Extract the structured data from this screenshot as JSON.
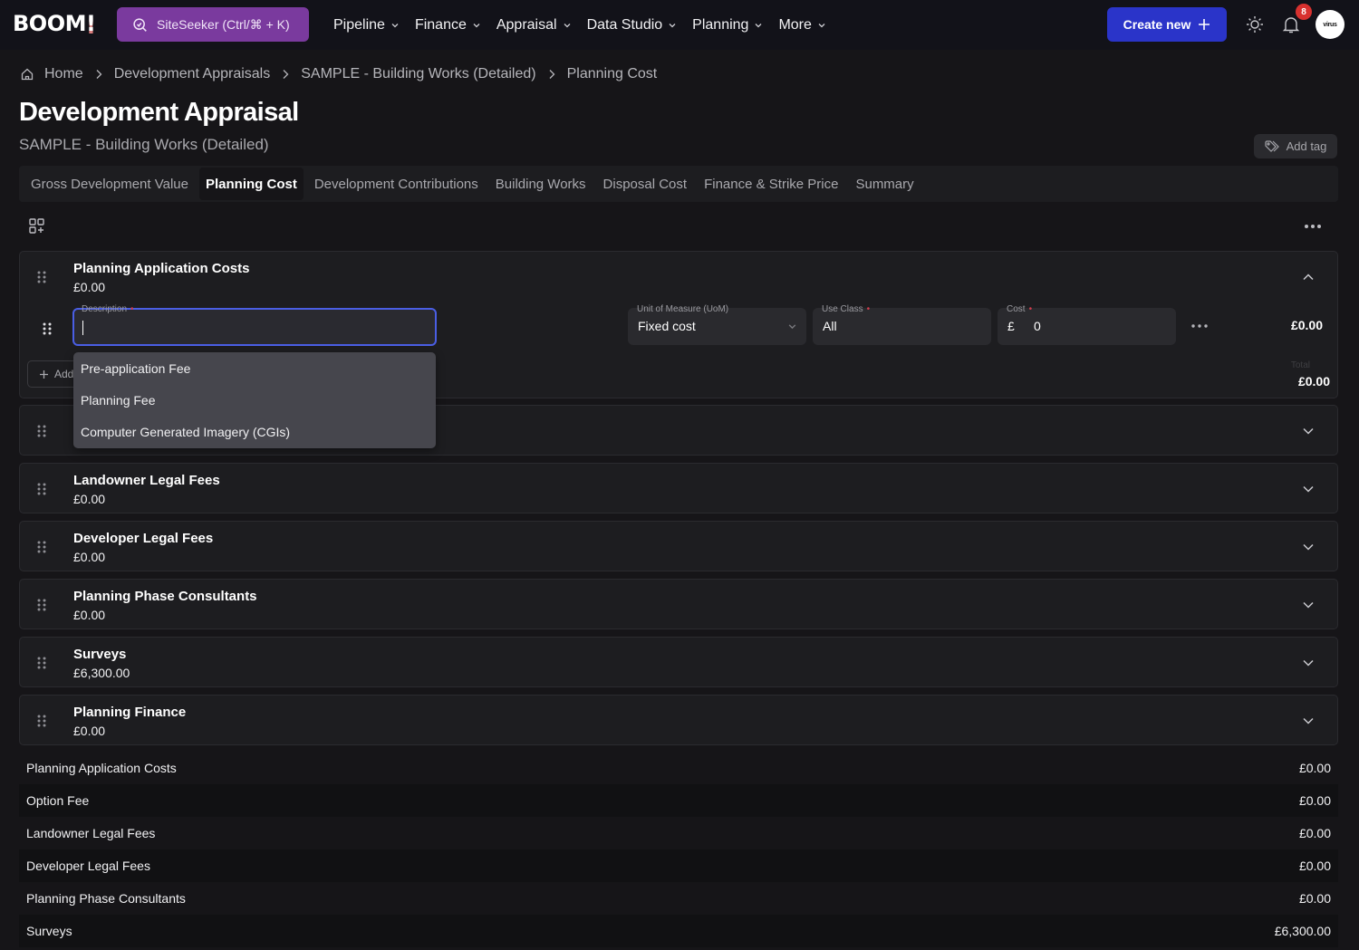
{
  "navbar": {
    "logo": "BOOM",
    "logo_bang": "!",
    "siteseeker_label": "SiteSeeker (Ctrl/⌘ + K)",
    "menu": [
      {
        "label": "Pipeline"
      },
      {
        "label": "Finance"
      },
      {
        "label": "Appraisal"
      },
      {
        "label": "Data Studio"
      },
      {
        "label": "Planning"
      },
      {
        "label": "More"
      }
    ],
    "create_new_label": "Create new",
    "notification_count": "8",
    "avatar_text": "virus"
  },
  "breadcrumb": [
    "Home",
    "Development Appraisals",
    "SAMPLE - Building Works (Detailed)",
    "Planning Cost"
  ],
  "header": {
    "title": "Development Appraisal",
    "subtitle": "SAMPLE - Building Works (Detailed)",
    "add_tag_label": "Add tag"
  },
  "tabs": [
    {
      "label": "Gross Development Value",
      "active": false
    },
    {
      "label": "Planning Cost",
      "active": true
    },
    {
      "label": "Development Contributions",
      "active": false
    },
    {
      "label": "Building Works",
      "active": false
    },
    {
      "label": "Disposal Cost",
      "active": false
    },
    {
      "label": "Finance & Strike Price",
      "active": false
    },
    {
      "label": "Summary",
      "active": false
    }
  ],
  "expanded_section": {
    "title": "Planning Application Costs",
    "amount": "£0.00",
    "row": {
      "description_label": "Description",
      "description_value": "",
      "uom_label": "Unit of Measure (UoM)",
      "uom_value": "Fixed cost",
      "use_class_label": "Use Class",
      "use_class_value": "All",
      "cost_label": "Cost",
      "cost_currency": "£",
      "cost_value": "0",
      "row_total": "£0.00"
    },
    "add_label": "Add",
    "total_label": "Total",
    "total_value": "£0.00"
  },
  "description_dropdown": [
    "Pre-application Fee",
    "Planning Fee",
    "Computer Generated Imagery (CGIs)"
  ],
  "sections": [
    {
      "title": "Option Fee",
      "amount": "£0.00"
    },
    {
      "title": "Landowner Legal Fees",
      "amount": "£0.00"
    },
    {
      "title": "Developer Legal Fees",
      "amount": "£0.00"
    },
    {
      "title": "Planning Phase Consultants",
      "amount": "£0.00"
    },
    {
      "title": "Surveys",
      "amount": "£6,300.00"
    },
    {
      "title": "Planning Finance",
      "amount": "£0.00"
    }
  ],
  "summary": [
    {
      "label": "Planning Application Costs",
      "value": "£0.00"
    },
    {
      "label": "Option Fee",
      "value": "£0.00"
    },
    {
      "label": "Landowner Legal Fees",
      "value": "£0.00"
    },
    {
      "label": "Developer Legal Fees",
      "value": "£0.00"
    },
    {
      "label": "Planning Phase Consultants",
      "value": "£0.00"
    },
    {
      "label": "Surveys",
      "value": "£6,300.00"
    }
  ],
  "colors": {
    "siteseeker": "#7a3a9e",
    "primary": "#2a34c9",
    "focus": "#4a5ee4",
    "badge": "#d8312f",
    "required": "#d13d4d"
  }
}
